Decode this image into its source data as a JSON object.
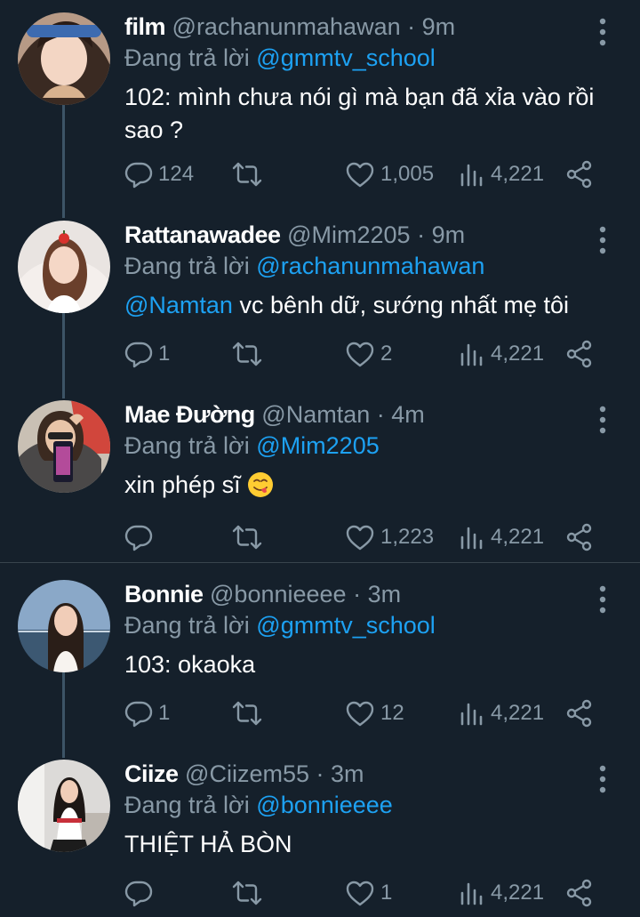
{
  "tweets": [
    {
      "name": "film",
      "handle": "@rachanunmahawan",
      "dot": "·",
      "time": "9m",
      "replying_prefix": "Đang trả lời",
      "replying_to": "@gmmtv_school",
      "text": "102: mình chưa nói gì mà bạn đã xỉa vào rồi sao ?",
      "replies": "124",
      "retweets": "",
      "likes": "1,005",
      "views": "4,221"
    },
    {
      "name": "Rattanawadee",
      "handle": "@Mim2205",
      "dot": "·",
      "time": "9m",
      "replying_prefix": "Đang trả lời",
      "replying_to": "@rachanunmahawan",
      "mention": "@Namtan",
      "text": " vc bênh dữ, sướng nhất mẹ tôi",
      "replies": "1",
      "retweets": "",
      "likes": "2",
      "views": "4,221"
    },
    {
      "name": "Mae Đường",
      "handle": "@Namtan",
      "dot": "·",
      "time": "4m",
      "replying_prefix": "Đang trả lời",
      "replying_to": "@Mim2205",
      "text": "xin phép sĩ ",
      "emoji": "face-savoring-food",
      "replies": "",
      "retweets": "",
      "likes": "1,223",
      "views": "4,221"
    },
    {
      "name": "Bonnie",
      "handle": "@bonnieeee",
      "dot": "·",
      "time": "3m",
      "replying_prefix": "Đang trả lời",
      "replying_to": "@gmmtv_school",
      "text": "103: okaoka",
      "replies": "1",
      "retweets": "",
      "likes": "12",
      "views": "4,221"
    },
    {
      "name": "Ciize",
      "handle": "@Ciizem55",
      "dot": "·",
      "time": "3m",
      "replying_prefix": "Đang trả lời",
      "replying_to": "@bonnieeee",
      "text": "THIỆT HẢ BÒN",
      "replies": "",
      "retweets": "",
      "likes": "1",
      "views": "4,221"
    }
  ],
  "colors": {
    "background": "#15202b",
    "secondary_text": "#8899a6",
    "link": "#1da1f2",
    "divider": "#38444d",
    "thread_line": "#3d5466"
  },
  "icons": {
    "reply": "speech-bubble-icon",
    "retweet": "retweet-arrows-icon",
    "like": "heart-icon",
    "views": "bar-chart-icon",
    "share": "share-nodes-icon",
    "more": "vertical-dots-icon"
  }
}
